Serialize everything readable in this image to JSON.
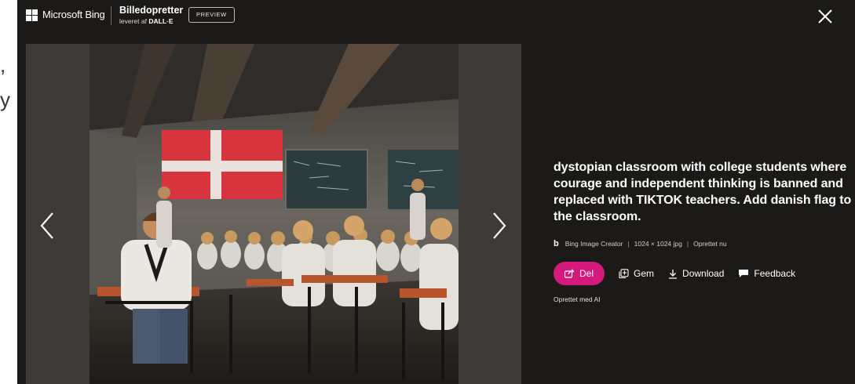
{
  "header": {
    "brand": "Microsoft Bing",
    "app_title": "Billedopretter",
    "app_sub_prefix": "leveret af",
    "app_sub_strong": "DALL·E",
    "badge": "PREVIEW"
  },
  "image": {
    "prompt_lines": [
      "dystopian classroom with college students where",
      "courage and independent thinking is banned and",
      "replaced with TIKTOK teachers. Add danish flag to",
      "the classroom."
    ],
    "source": "Bing Image Creator",
    "size": "1024 × 1024 jpg",
    "created": "Oprettet nu"
  },
  "actions": {
    "share": "Del",
    "save": "Gem",
    "download": "Download",
    "feedback": "Feedback"
  },
  "footer_note": "Oprettet med AI",
  "colors": {
    "modal_bg": "#1b1a19",
    "accent": "#d6197c",
    "flag_red": "#d8343d"
  },
  "icons": [
    "microsoft-logo-icon",
    "close-icon",
    "chevron-left-icon",
    "chevron-right-icon",
    "bing-icon",
    "share-icon",
    "save-icon",
    "download-icon",
    "feedback-icon"
  ]
}
